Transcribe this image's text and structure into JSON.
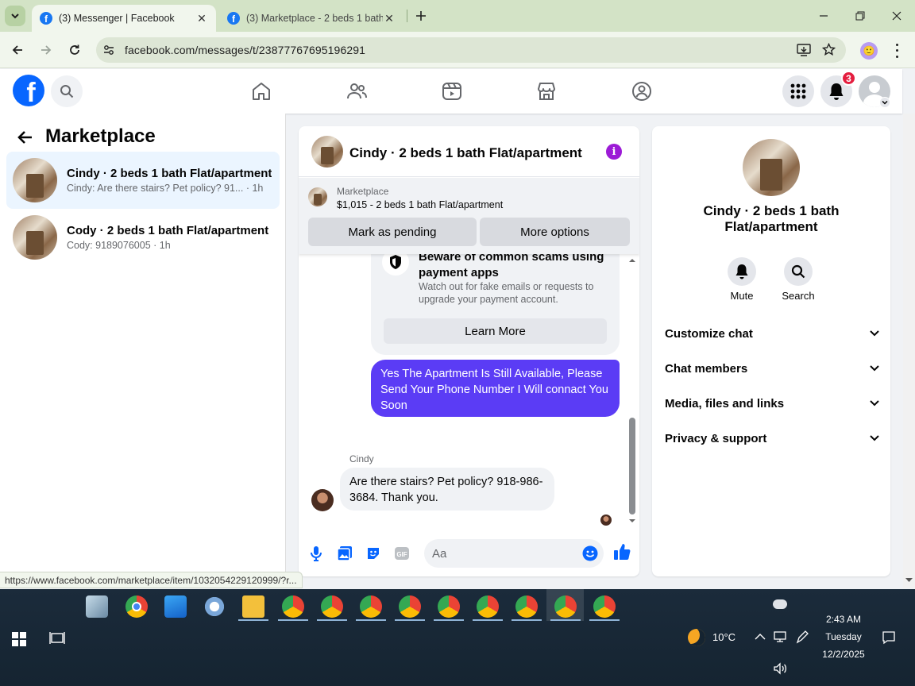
{
  "browser": {
    "tabs": [
      {
        "title": "(3) Messenger | Facebook",
        "active": true
      },
      {
        "title": "(3) Marketplace - 2 beds 1 bath",
        "active": false
      }
    ],
    "url": "facebook.com/messages/t/23877767695196291",
    "status_url": "https://www.facebook.com/marketplace/item/1032054229120999/?r..."
  },
  "fb_header": {
    "notification_count": "3",
    "icons": [
      "home-icon",
      "friends-icon",
      "video-icon",
      "marketplace-icon",
      "groups-icon"
    ]
  },
  "left_panel": {
    "title": "Marketplace",
    "conversations": [
      {
        "name": "Cindy · 2 beds 1 bath Flat/apartment",
        "preview": "Cindy: Are there stairs? Pet policy? 91...",
        "time": "· 1h",
        "selected": true
      },
      {
        "name": "Cody · 2 beds 1 bath Flat/apartment",
        "preview": "Cody: 9189076005",
        "time": "· 1h",
        "selected": false
      }
    ]
  },
  "chat": {
    "title": "Cindy · 2 beds 1 bath Flat/apartment",
    "listing_label": "Marketplace",
    "listing_text": "$1,015 - 2 beds 1 bath Flat/apartment",
    "mark_pending": "Mark as pending",
    "more_options": "More options",
    "scam_title": "Beware of common scams using payment apps",
    "scam_body": "Watch out for fake emails or requests to upgrade your payment account.",
    "learn_more": "Learn More",
    "outgoing_message": "Yes The Apartment Is Still Available, Please Send Your Phone Number I Will connact You Soon",
    "incoming_sender": "Cindy",
    "incoming_message": "Are there stairs?  Pet policy?  918-986-3684.  Thank you.",
    "composer_placeholder": "Aa",
    "accent": "#5b3cf5"
  },
  "right_panel": {
    "name": "Cindy · 2 beds 1 bath Flat/apartment",
    "mute": "Mute",
    "search": "Search",
    "sections": [
      "Customize chat",
      "Chat members",
      "Media, files and links",
      "Privacy & support"
    ]
  },
  "taskbar": {
    "weather": "10°C",
    "time": "2:43 AM",
    "day": "Tuesday",
    "date": "12/2/2025"
  }
}
